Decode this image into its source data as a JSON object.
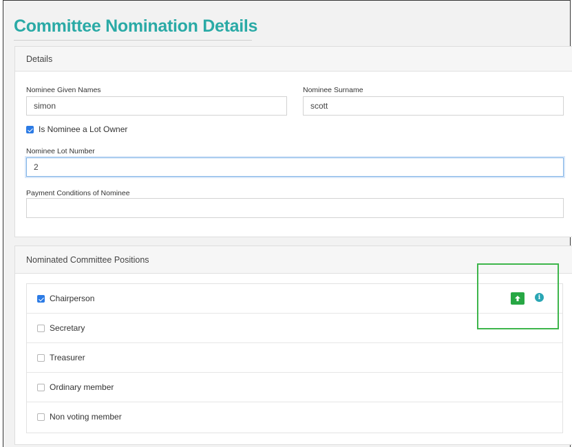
{
  "page": {
    "title": "Committee Nomination Details"
  },
  "details_panel": {
    "header": "Details",
    "given_names": {
      "label": "Nominee Given Names",
      "value": "simon"
    },
    "surname": {
      "label": "Nominee Surname",
      "value": "scott"
    },
    "lot_owner": {
      "label": "Is Nominee a Lot Owner",
      "checked": true
    },
    "lot_number": {
      "label": "Nominee Lot Number",
      "value": "2"
    },
    "payment_conditions": {
      "label": "Payment Conditions of Nominee",
      "value": ""
    }
  },
  "positions_panel": {
    "header": "Nominated Committee Positions",
    "positions": [
      {
        "label": "Chairperson",
        "checked": true
      },
      {
        "label": "Secretary",
        "checked": false
      },
      {
        "label": "Treasurer",
        "checked": false
      },
      {
        "label": "Ordinary member",
        "checked": false
      },
      {
        "label": "Non voting member",
        "checked": false
      }
    ]
  },
  "icons": {
    "action_button": "upload-icon",
    "info": "info-icon"
  },
  "colors": {
    "title": "#2aaaa6",
    "checkbox_checked": "#2c7be5",
    "action_green": "#27a744",
    "info": "#2aa6b4",
    "highlight": "#3cb54a"
  }
}
